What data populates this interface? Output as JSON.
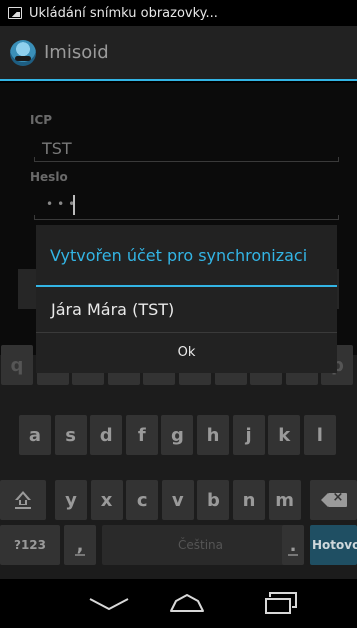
{
  "status_bar": {
    "notification_text": "Ukládání snímku obrazovky..."
  },
  "action_bar": {
    "app_title": "Imisoid",
    "accent_color": "#33b5e5"
  },
  "form": {
    "icp_label": "ICP",
    "icp_value": "TST",
    "password_label": "Heslo",
    "password_mask": "•••"
  },
  "dialog": {
    "title": "Vytvořen účet pro synchronizaci",
    "message": "Jára Mára (TST)",
    "ok_label": "Ok"
  },
  "keyboard": {
    "row1": [
      "q",
      "w",
      "e",
      "r",
      "t",
      "z",
      "u",
      "i",
      "o",
      "p"
    ],
    "row2": [
      "a",
      "s",
      "d",
      "f",
      "g",
      "h",
      "j",
      "k",
      "l"
    ],
    "row3": [
      "y",
      "x",
      "c",
      "v",
      "b",
      "n",
      "m"
    ],
    "symbols_label": "?123",
    "comma_label": ",",
    "space_label": "Čeština",
    "period_label": ".",
    "action_label": "Hotovo",
    "shift_icon": "shift-icon",
    "backspace_icon": "backspace-icon"
  },
  "nav_bar": {
    "back_icon": "back-icon",
    "home_icon": "home-icon",
    "recents_icon": "recents-icon"
  }
}
